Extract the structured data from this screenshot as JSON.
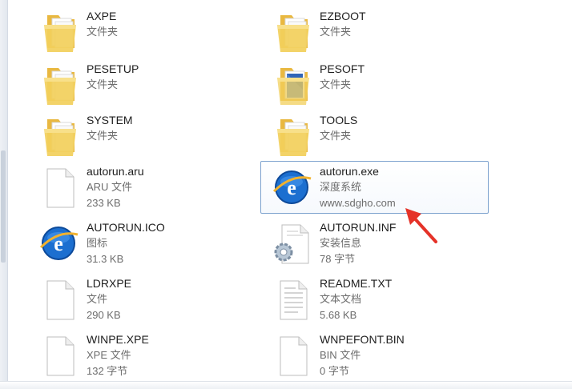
{
  "files": [
    {
      "name": "AXPE",
      "line2": "文件夹",
      "line3": "",
      "icon": "folder-icon"
    },
    {
      "name": "EZBOOT",
      "line2": "文件夹",
      "line3": "",
      "icon": "folder-icon"
    },
    {
      "name": "PESETUP",
      "line2": "文件夹",
      "line3": "",
      "icon": "folder-icon"
    },
    {
      "name": "PESOFT",
      "line2": "文件夹",
      "line3": "",
      "icon": "folder-doc-icon"
    },
    {
      "name": "SYSTEM",
      "line2": "文件夹",
      "line3": "",
      "icon": "folder-icon"
    },
    {
      "name": "TOOLS",
      "line2": "文件夹",
      "line3": "",
      "icon": "folder-icon"
    },
    {
      "name": "autorun.aru",
      "line2": "ARU 文件",
      "line3": "233 KB",
      "icon": "blank-file-icon"
    },
    {
      "name": "autorun.exe",
      "line2": "深度系统",
      "line3": "www.sdgho.com",
      "icon": "ie-app-icon",
      "selected": true
    },
    {
      "name": "AUTORUN.ICO",
      "line2": "图标",
      "line3": "31.3 KB",
      "icon": "ie-icon-file-icon"
    },
    {
      "name": "AUTORUN.INF",
      "line2": "安装信息",
      "line3": "78 字节",
      "icon": "settings-file-icon"
    },
    {
      "name": "LDRXPE",
      "line2": "文件",
      "line3": "290 KB",
      "icon": "blank-file-icon"
    },
    {
      "name": "README.TXT",
      "line2": "文本文档",
      "line3": "5.68 KB",
      "icon": "text-file-icon"
    },
    {
      "name": "WINPE.XPE",
      "line2": "XPE 文件",
      "line3": "132 字节",
      "icon": "blank-file-icon"
    },
    {
      "name": "WNPEFONT.BIN",
      "line2": "BIN 文件",
      "line3": "0 字节",
      "icon": "blank-file-icon"
    }
  ],
  "colors": {
    "selection_border": "#7da2ce",
    "folder": "#f2cf5b",
    "arrow": "#e53228",
    "ie_blue": "#1c6fd0"
  }
}
